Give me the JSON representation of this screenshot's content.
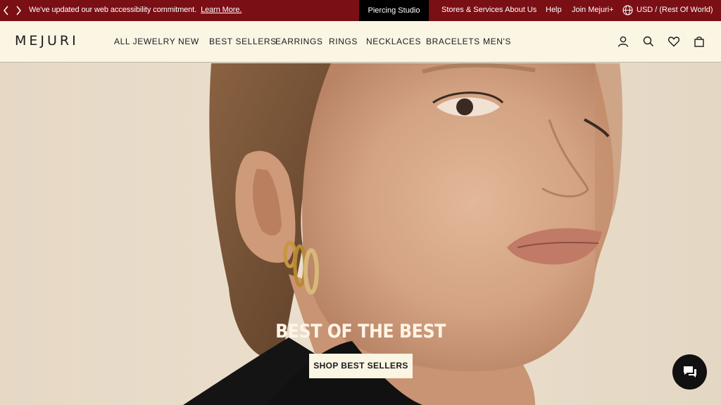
{
  "announcement": {
    "text": "We've updated our web accessibility commitment.",
    "link": "Learn More."
  },
  "utility": {
    "piercing": "Piercing Studio",
    "stores": "Stores & Services",
    "about": "About Us",
    "help": "Help",
    "join": "Join Mejuri+",
    "currency": "USD / (Rest Of World)"
  },
  "header": {
    "logo": "MEJURI",
    "nav": [
      "ALL JEWELRY",
      "NEW",
      "BEST SELLERS",
      "EARRINGS",
      "RINGS",
      "NECKLACES",
      "BRACELETS",
      "MEN'S"
    ]
  },
  "hero": {
    "title": "BEST OF THE BEST",
    "button": "SHOP BEST SELLERS"
  },
  "colors": {
    "announcement_bg": "#7a0f15",
    "header_bg": "#fbf5e4",
    "hero_bg": "#e9ddcc"
  },
  "icons": [
    "chevron-left-icon",
    "chevron-right-icon",
    "globe-icon",
    "account-icon",
    "search-icon",
    "heart-icon",
    "bag-icon",
    "chat-icon"
  ]
}
